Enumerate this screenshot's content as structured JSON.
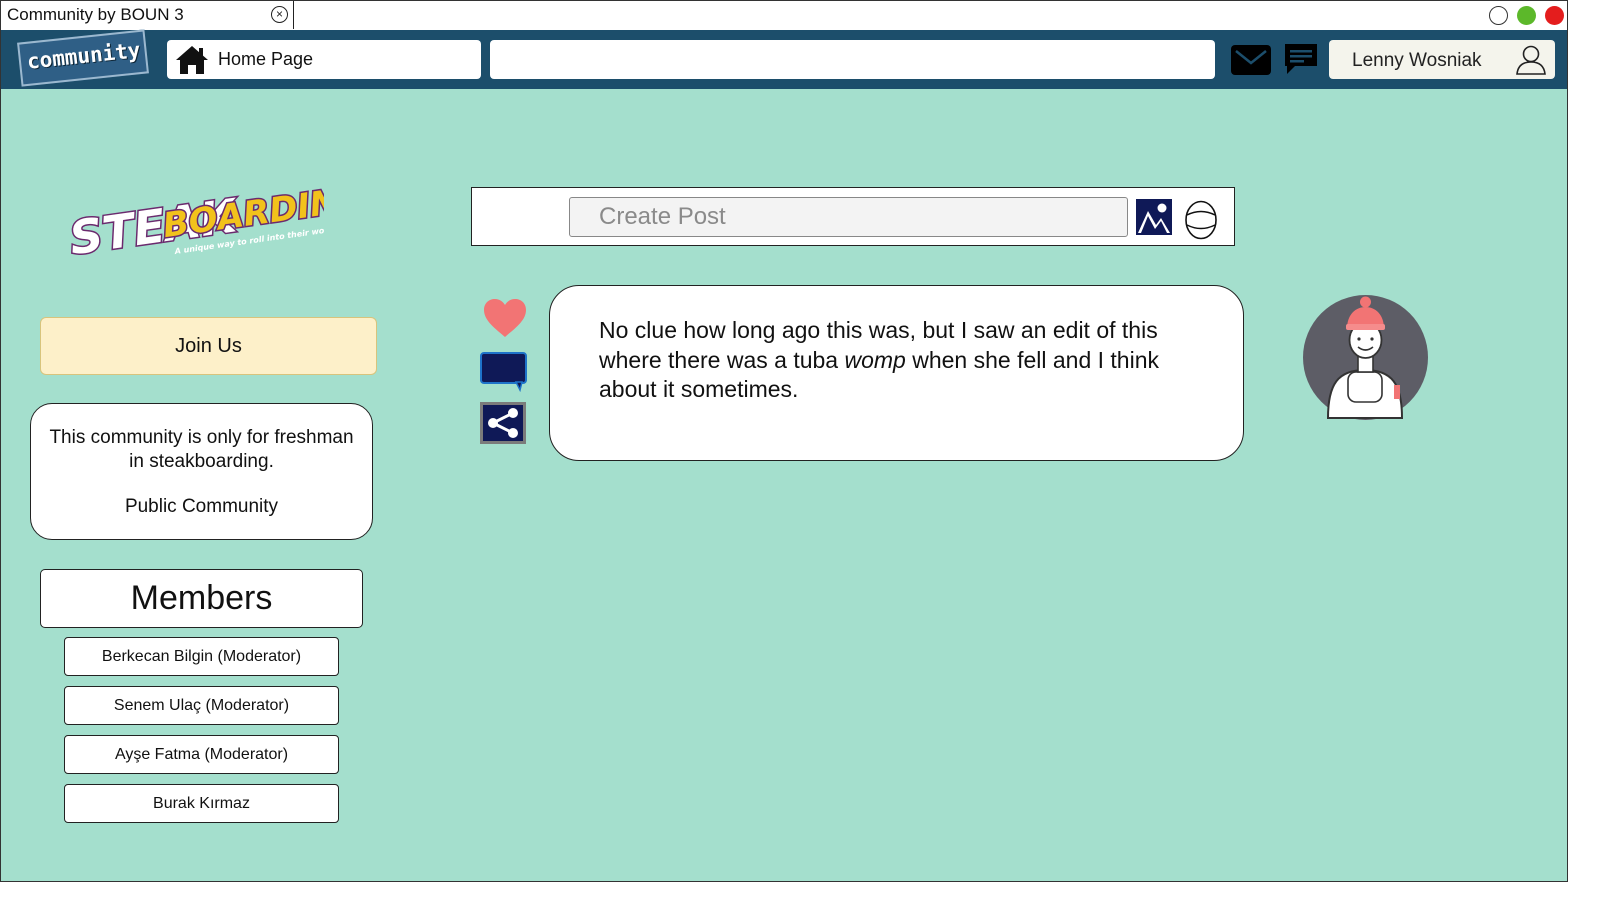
{
  "window": {
    "tab_title": "Community by BOUN 3",
    "tab_close_symbol": "×"
  },
  "nav": {
    "logo_text": "community",
    "home_label": "Home Page",
    "search_value": "",
    "user_name": "Lenny Wosniak",
    "icons": [
      "home-icon",
      "mail-icon",
      "messages-icon",
      "user-icon"
    ]
  },
  "community": {
    "brand_title": "STEAKBOARDING",
    "brand_tagline": "A unique way to roll into their world",
    "join_label": "Join Us",
    "description": "This community is only for freshman in steakboarding.",
    "visibility": "Public Community",
    "members_title": "Members",
    "members": [
      "Berkecan Bilgin (Moderator)",
      "Senem Ulaç (Moderator)",
      "Ayşe Fatma (Moderator)",
      "Burak Kırmaz"
    ]
  },
  "composer": {
    "placeholder": "Create Post",
    "icons": [
      "image-icon",
      "emoji-icon"
    ]
  },
  "post": {
    "text_before": "No clue how long ago this was, but I saw an edit of this where there was a tuba ",
    "text_em": "womp",
    "text_after": " when she fell and I think about it sometimes.",
    "actions": [
      "like-heart-icon",
      "comment-icon",
      "share-icon"
    ]
  },
  "colors": {
    "background": "#a4dfcd",
    "navbar": "#1c4e6b",
    "join_button": "#fdf0c9",
    "heart": "#f27474",
    "icon_navy": "#0f1957"
  }
}
